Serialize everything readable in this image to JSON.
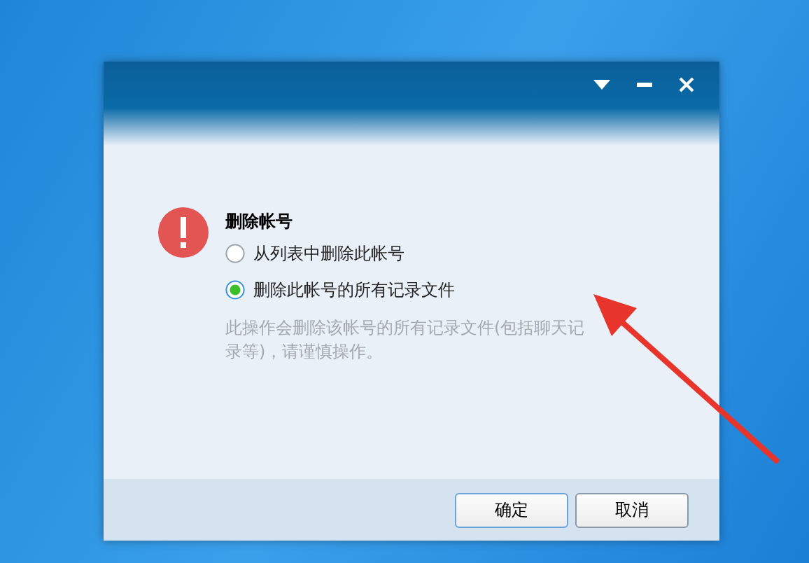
{
  "title_bar": {
    "buttons": [
      {
        "kind": "menu"
      },
      {
        "kind": "minimize"
      },
      {
        "kind": "close"
      }
    ]
  },
  "dialog": {
    "heading": "删除帐号",
    "options": [
      {
        "label": "从列表中删除此帐号",
        "selected": false
      },
      {
        "label": "删除此帐号的所有记录文件",
        "selected": true
      }
    ],
    "note": "此操作会删除该帐号的所有记录文件(包括聊天记录等)，请谨慎操作。"
  },
  "buttons": [
    {
      "label": "确定",
      "kind": "primary"
    },
    {
      "label": "取消",
      "kind": "secondary"
    }
  ]
}
